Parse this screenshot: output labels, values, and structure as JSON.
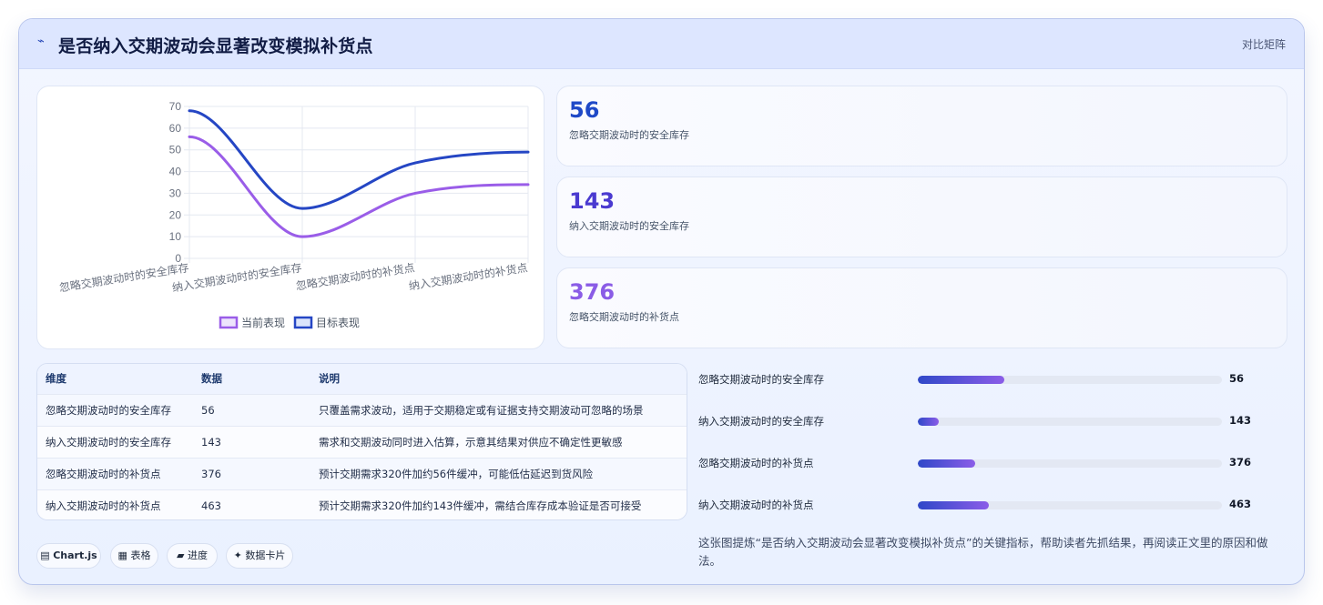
{
  "header": {
    "icon": "sparkline-icon",
    "icon_glyph": "⌁",
    "title": "是否纳入交期波动会显著改变模拟补货点",
    "tag": "对比矩阵"
  },
  "chart_data": {
    "type": "line",
    "categories": [
      "忽略交期波动时的安全库存",
      "纳入交期波动时的安全库存",
      "忽略交期波动时的补货点",
      "纳入交期波动时的补货点"
    ],
    "y_ticks": [
      "0",
      "10",
      "20",
      "30",
      "40",
      "50",
      "60",
      "70"
    ],
    "ylim": [
      0,
      70
    ],
    "grid": true,
    "legend_position": "bottom",
    "series": [
      {
        "name": "当前表现",
        "values": [
          56,
          10,
          30,
          34
        ],
        "color": "#9a5de8"
      },
      {
        "name": "目标表现",
        "values": [
          68,
          23,
          44,
          49
        ],
        "color": "#2546c4"
      }
    ]
  },
  "kpis": [
    {
      "value": "56",
      "label": "忽略交期波动时的安全库存",
      "color": "#1f49c7"
    },
    {
      "value": "143",
      "label": "纳入交期波动时的安全库存",
      "color": "#4a3ad0"
    },
    {
      "value": "376",
      "label": "忽略交期波动时的补货点",
      "color": "#8a5ce6"
    }
  ],
  "table": {
    "headers": [
      "维度",
      "数据",
      "说明"
    ],
    "rows": [
      [
        "忽略交期波动时的安全库存",
        "56",
        "只覆盖需求波动，适用于交期稳定或有证据支持交期波动可忽略的场景"
      ],
      [
        "纳入交期波动时的安全库存",
        "143",
        "需求和交期波动同时进入估算，示意其结果对供应不确定性更敏感"
      ],
      [
        "忽略交期波动时的补货点",
        "376",
        "预计交期需求320件加约56件缓冲，可能低估延迟到货风险"
      ],
      [
        "纳入交期波动时的补货点",
        "463",
        "预计交期需求320件加约143件缓冲，需结合库存成本验证是否可接受"
      ]
    ]
  },
  "chips": [
    {
      "icon": "chart-icon",
      "glyph": "▤",
      "label": "Chart.js"
    },
    {
      "icon": "table-icon",
      "glyph": "▦",
      "label": "表格"
    },
    {
      "icon": "progress-icon",
      "glyph": "▰",
      "label": "进度"
    },
    {
      "icon": "card-icon",
      "glyph": "✦",
      "label": "数据卡片"
    }
  ],
  "bars": [
    {
      "label": "忽略交期波动时的安全库存",
      "value": "56",
      "fraction": 0.285
    },
    {
      "label": "纳入交期波动时的安全库存",
      "value": "143",
      "fraction": 0.07
    },
    {
      "label": "忽略交期波动时的补货点",
      "value": "376",
      "fraction": 0.19
    },
    {
      "label": "纳入交期波动时的补货点",
      "value": "463",
      "fraction": 0.235
    }
  ],
  "summary": "这张图提炼“是否纳入交期波动会显著改变模拟补货点”的关键指标，帮助读者先抓结果，再阅读正文里的原因和做法。"
}
